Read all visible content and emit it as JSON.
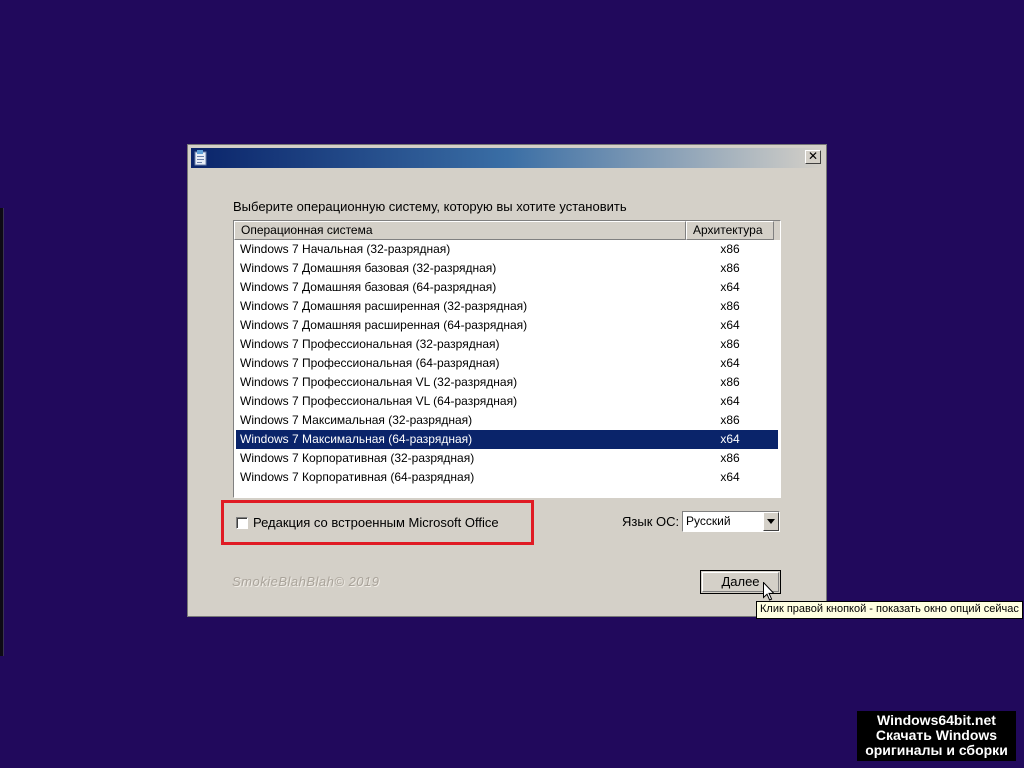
{
  "dialog": {
    "heading": "Выберите операционную систему, которую вы хотите установить",
    "close_symbol": "✕"
  },
  "list": {
    "columns": {
      "os": "Операционная система",
      "arch": "Архитектура"
    },
    "selected_index": 10,
    "rows": [
      {
        "os": "Windows 7 Начальная (32-разрядная)",
        "arch": "x86"
      },
      {
        "os": "Windows 7 Домашняя базовая (32-разрядная)",
        "arch": "x86"
      },
      {
        "os": "Windows 7 Домашняя базовая (64-разрядная)",
        "arch": "x64"
      },
      {
        "os": "Windows 7 Домашняя расширенная (32-разрядная)",
        "arch": "x86"
      },
      {
        "os": "Windows 7 Домашняя расширенная (64-разрядная)",
        "arch": "x64"
      },
      {
        "os": "Windows 7 Профессиональная (32-разрядная)",
        "arch": "x86"
      },
      {
        "os": "Windows 7 Профессиональная (64-разрядная)",
        "arch": "x64"
      },
      {
        "os": "Windows 7 Профессиональная VL (32-разрядная)",
        "arch": "x86"
      },
      {
        "os": "Windows 7 Профессиональная VL (64-разрядная)",
        "arch": "x64"
      },
      {
        "os": "Windows 7 Максимальная (32-разрядная)",
        "arch": "x86"
      },
      {
        "os": "Windows 7 Максимальная (64-разрядная)",
        "arch": "x64"
      },
      {
        "os": "Windows 7 Корпоративная (32-разрядная)",
        "arch": "x86"
      },
      {
        "os": "Windows 7 Корпоративная (64-разрядная)",
        "arch": "x64"
      }
    ]
  },
  "options": {
    "office_checkbox_label": "Редакция со встроенным Microsoft Office",
    "office_checked": false,
    "language_label": "Язык ОС:",
    "language_value": "Русский"
  },
  "footer": {
    "copyright": "SmokieBlahBlah© 2019",
    "next_label": "Далее"
  },
  "tooltip": {
    "text": "Клик правой кнопкой - показать окно опций сейчас"
  },
  "watermark": {
    "line1": "Windows64bit.net",
    "line2": "Скачать Windows",
    "line3": "оригиналы и сборки"
  },
  "colors": {
    "desktop_background": "#21095c",
    "selection": "#0a246a",
    "highlight_frame": "#e01b24",
    "tooltip_background": "#ffffe1"
  },
  "icons": {
    "window_icon": "setup-window-icon",
    "close": "close-icon",
    "dropdown": "dropdown-arrow-icon",
    "cursor": "mouse-cursor-icon"
  }
}
